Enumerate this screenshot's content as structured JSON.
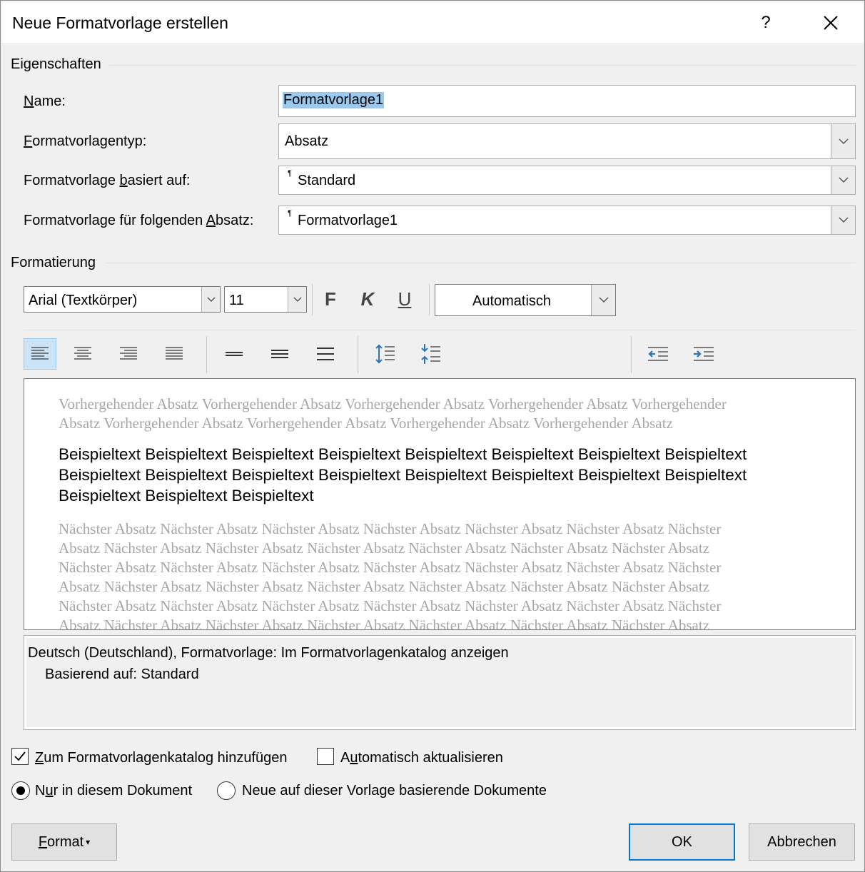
{
  "window": {
    "title": "Neue Formatvorlage erstellen",
    "help_glyph": "?",
    "close_glyph": "✕"
  },
  "properties": {
    "section_label": "Eigenschaften",
    "name": {
      "label_u": "N",
      "label_rest": "ame:",
      "value": "Formatvorlage1"
    },
    "style_type": {
      "label_u": "F",
      "label_rest": "ormatvorlagentyp:",
      "value": "Absatz"
    },
    "based_on": {
      "label_pre": "Formatvorlage ",
      "label_u": "b",
      "label_rest": "asiert auf:",
      "pilcrow": "¶",
      "value": "Standard"
    },
    "next_style": {
      "label_pre": "Formatvorlage für folgenden ",
      "label_u": "A",
      "label_rest": "bsatz:",
      "pilcrow": "¶",
      "value": "Formatvorlage1"
    }
  },
  "formatting": {
    "section_label": "Formatierung",
    "font": "Arial (Textkörper)",
    "size": "11",
    "bold_label": "F",
    "italic_label": "K",
    "underline_label": "U",
    "color": "Automatisch"
  },
  "toolbar": {
    "icons": [
      "align-left-icon",
      "align-center-icon",
      "align-right-icon",
      "justify-icon",
      "single-spacing-icon",
      "one-half-spacing-icon",
      "double-spacing-icon",
      "increase-paragraph-spacing-icon",
      "decrease-paragraph-spacing-icon",
      "decrease-indent-icon",
      "increase-indent-icon"
    ],
    "active": "align-left-icon",
    "accent": "#2e75b6"
  },
  "preview": {
    "previous": [
      "Vorhergehender Absatz Vorhergehender Absatz Vorhergehender Absatz Vorhergehender Absatz Vorhergehender",
      "Absatz Vorhergehender Absatz Vorhergehender Absatz Vorhergehender Absatz Vorhergehender Absatz"
    ],
    "sample": [
      "Beispieltext Beispieltext Beispieltext Beispieltext Beispieltext Beispieltext Beispieltext Beispieltext",
      "Beispieltext Beispieltext Beispieltext Beispieltext Beispieltext Beispieltext Beispieltext Beispieltext",
      "Beispieltext Beispieltext Beispieltext"
    ],
    "next": [
      "Nächster Absatz Nächster Absatz Nächster Absatz Nächster Absatz Nächster Absatz Nächster Absatz Nächster",
      "Absatz Nächster Absatz Nächster Absatz Nächster Absatz Nächster Absatz Nächster Absatz Nächster Absatz",
      "Nächster Absatz Nächster Absatz Nächster Absatz Nächster Absatz Nächster Absatz Nächster Absatz Nächster",
      "Absatz Nächster Absatz Nächster Absatz Nächster Absatz Nächster Absatz Nächster Absatz Nächster Absatz",
      "Nächster Absatz Nächster Absatz Nächster Absatz Nächster Absatz Nächster Absatz Nächster Absatz Nächster",
      "Absatz Nächster Absatz Nächster Absatz Nächster Absatz Nächster Absatz Nächster Absatz Nächster Absatz"
    ]
  },
  "description": {
    "line1": "Deutsch (Deutschland), Formatvorlage: Im Formatvorlagenkatalog anzeigen",
    "line2": "Basierend auf: Standard"
  },
  "options": {
    "add_to_gallery": {
      "label_u": "Z",
      "label_rest": "um Formatvorlagenkatalog hinzufügen",
      "checked": true
    },
    "auto_update": {
      "label_pre": "A",
      "label_u": "u",
      "label_rest": "tomatisch aktualisieren",
      "checked": false
    },
    "only_this_doc": {
      "label_pre": "N",
      "label_u": "u",
      "label_rest": "r in diesem Dokument",
      "selected": true
    },
    "new_docs": {
      "label": "Neue auf dieser Vorlage basierende Dokumente",
      "selected": false
    }
  },
  "buttons": {
    "format_u": "F",
    "format_rest": "ormat",
    "format_caret": "▾",
    "ok": "OK",
    "cancel": "Abbrechen"
  }
}
